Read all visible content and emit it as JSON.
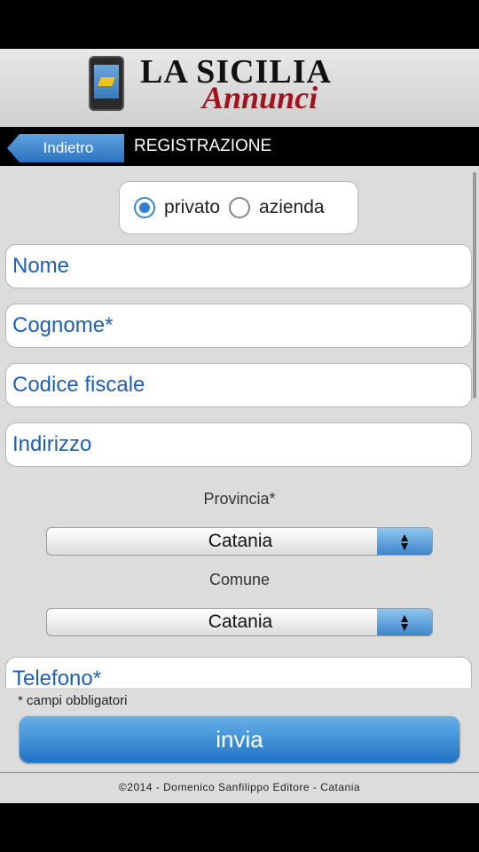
{
  "header": {
    "brand_title": "LA SICILIA",
    "brand_subtitle": "Annunci"
  },
  "navbar": {
    "back_label": "Indietro",
    "title": "REGISTRAZIONE"
  },
  "account_type": {
    "options": [
      {
        "label": "privato",
        "selected": true
      },
      {
        "label": "azienda",
        "selected": false
      }
    ]
  },
  "fields": {
    "nome": "Nome",
    "cognome": "Cognome*",
    "codice_fiscale": "Codice fiscale",
    "indirizzo": "Indirizzo",
    "telefono": "Telefono*"
  },
  "provincia": {
    "label": "Provincia*",
    "value": "Catania"
  },
  "comune": {
    "label": "Comune",
    "value": "Catania"
  },
  "footer": {
    "required_note": "* campi obbligatori",
    "submit_label": "invia",
    "copyright": "©2014 - Domenico Sanfilippo Editore - Catania"
  },
  "colors": {
    "accent": "#2f7dd1",
    "field_text": "#1f5fb3",
    "brand_red": "#a3121f"
  }
}
